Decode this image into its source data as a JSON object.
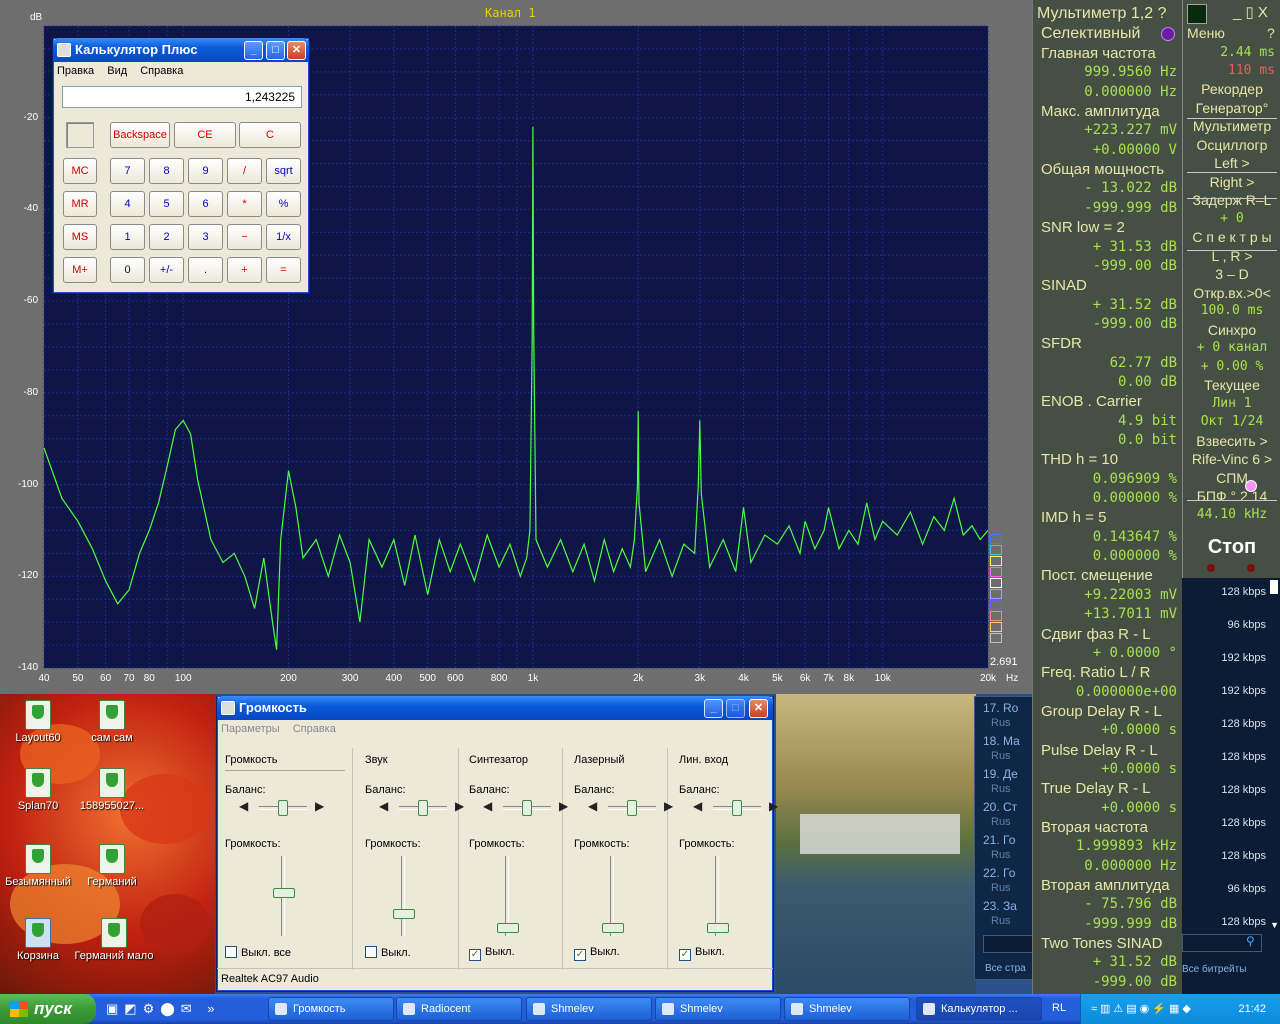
{
  "spectrum": {
    "channel_title": "Канал 1",
    "unit_db": "dB",
    "corner_value": "2.691",
    "unit_hz": "Hz",
    "colors": {
      "plot_bg": "#101548",
      "trace": "#4cff3c",
      "grid": "#1e2f8a",
      "frame": "#6e6e6e"
    },
    "chart_data": {
      "type": "line",
      "title": "Канал 1",
      "xlabel": "Hz",
      "ylabel": "dB",
      "x_scale": "log",
      "xlim": [
        40,
        20000
      ],
      "ylim": [
        -140,
        0
      ],
      "x_ticks": [
        "40",
        "50",
        "60",
        "70",
        "80",
        "100",
        "200",
        "300",
        "400",
        "500",
        "600",
        "800",
        "1k",
        "2k",
        "3k",
        "4k",
        "5k",
        "6k",
        "7k",
        "8k",
        "10k",
        "20k"
      ],
      "y_ticks": [
        "-20",
        "-40",
        "-60",
        "-80",
        "-100",
        "-120",
        "-140"
      ],
      "grid": true,
      "series": [
        {
          "points": [
            [
              40,
              -92
            ],
            [
              45,
              -103
            ],
            [
              50,
              -108
            ],
            [
              55,
              -114
            ],
            [
              60,
              -121
            ],
            [
              65,
              -126
            ],
            [
              70,
              -123
            ],
            [
              75,
              -115
            ],
            [
              80,
              -110
            ],
            [
              85,
              -104
            ],
            [
              90,
              -96
            ],
            [
              95,
              -88
            ],
            [
              100,
              -86
            ],
            [
              105,
              -89
            ],
            [
              110,
              -99
            ],
            [
              120,
              -112
            ],
            [
              130,
              -117
            ],
            [
              140,
              -115
            ],
            [
              150,
              -120
            ],
            [
              160,
              -127
            ],
            [
              170,
              -116
            ],
            [
              180,
              -130
            ],
            [
              185,
              -136
            ],
            [
              190,
              -112
            ],
            [
              200,
              -97
            ],
            [
              210,
              -105
            ],
            [
              220,
              -116
            ],
            [
              240,
              -112
            ],
            [
              260,
              -120
            ],
            [
              280,
              -111
            ],
            [
              300,
              -117
            ],
            [
              320,
              -130
            ],
            [
              340,
              -112
            ],
            [
              370,
              -118
            ],
            [
              400,
              -112
            ],
            [
              430,
              -122
            ],
            [
              460,
              -111
            ],
            [
              500,
              -124
            ],
            [
              540,
              -112
            ],
            [
              580,
              -119
            ],
            [
              620,
              -113
            ],
            [
              680,
              -121
            ],
            [
              740,
              -111
            ],
            [
              800,
              -118
            ],
            [
              860,
              -113
            ],
            [
              920,
              -120
            ],
            [
              960,
              -116
            ],
            [
              980,
              -110
            ],
            [
              995,
              -68
            ],
            [
              1000,
              -22
            ],
            [
              1005,
              -66
            ],
            [
              1020,
              -112
            ],
            [
              1100,
              -118
            ],
            [
              1200,
              -112
            ],
            [
              1300,
              -119
            ],
            [
              1400,
              -113
            ],
            [
              1500,
              -121
            ],
            [
              1600,
              -112
            ],
            [
              1700,
              -119
            ],
            [
              1800,
              -114
            ],
            [
              1900,
              -118
            ],
            [
              1950,
              -112
            ],
            [
              1990,
              -100
            ],
            [
              2000,
              -84
            ],
            [
              2010,
              -104
            ],
            [
              2100,
              -119
            ],
            [
              2300,
              -112
            ],
            [
              2500,
              -120
            ],
            [
              2700,
              -113
            ],
            [
              2900,
              -115
            ],
            [
              2970,
              -100
            ],
            [
              3000,
              -86
            ],
            [
              3030,
              -102
            ],
            [
              3200,
              -118
            ],
            [
              3500,
              -112
            ],
            [
              3800,
              -119
            ],
            [
              4000,
              -105
            ],
            [
              4200,
              -117
            ],
            [
              4600,
              -111
            ],
            [
              5000,
              -113
            ],
            [
              5400,
              -109
            ],
            [
              5800,
              -115
            ],
            [
              6000,
              -108
            ],
            [
              6400,
              -114
            ],
            [
              6800,
              -110
            ],
            [
              7000,
              -105
            ],
            [
              7500,
              -114
            ],
            [
              8000,
              -110
            ],
            [
              8500,
              -113
            ],
            [
              9000,
              -104
            ],
            [
              9500,
              -112
            ],
            [
              10000,
              -108
            ],
            [
              11000,
              -111
            ],
            [
              12000,
              -106
            ],
            [
              13000,
              -113
            ],
            [
              14000,
              -107
            ],
            [
              15000,
              -110
            ],
            [
              16000,
              -103
            ],
            [
              17000,
              -111
            ],
            [
              18000,
              -109
            ],
            [
              19000,
              -112
            ],
            [
              20000,
              -110
            ]
          ]
        }
      ]
    }
  },
  "calculator": {
    "title": "Калькулятор Плюс",
    "menu": [
      "Правка",
      "Вид",
      "Справка"
    ],
    "display": "1,243225",
    "top_buttons": [
      "Backspace",
      "CE",
      "C"
    ],
    "memory": [
      "MC",
      "MR",
      "MS",
      "M+"
    ],
    "rows": [
      [
        "7",
        "8",
        "9",
        "/",
        "sqrt"
      ],
      [
        "4",
        "5",
        "6",
        "*",
        "%"
      ],
      [
        "1",
        "2",
        "3",
        "−",
        "1/x"
      ],
      [
        "0",
        "+/-",
        ".",
        "+",
        "="
      ]
    ]
  },
  "volume": {
    "title": "Громкость",
    "menu": [
      "Параметры",
      "Справка"
    ],
    "balance_label": "Баланс:",
    "volume_label": "Громкость:",
    "channels": [
      {
        "name": "Громкость",
        "mute": "Выкл. все",
        "checked": false,
        "level": 0.55
      },
      {
        "name": "Звук",
        "mute": "Выкл.",
        "checked": false,
        "level": 0.25
      },
      {
        "name": "Синтезатор",
        "mute": "Выкл.",
        "checked": true,
        "level": 0.05
      },
      {
        "name": "Лазерный",
        "mute": "Выкл.",
        "checked": true,
        "level": 0.05
      },
      {
        "name": "Лин. вход",
        "mute": "Выкл.",
        "checked": true,
        "level": 0.05
      }
    ],
    "device": "Realtek AC97 Audio"
  },
  "desktop_icons": [
    {
      "label": "Layout60"
    },
    {
      "label": "сам сам"
    },
    {
      "label": "Splan70"
    },
    {
      "label": "158955027..."
    },
    {
      "label": "Безымянный"
    },
    {
      "label": "Германий"
    },
    {
      "label": "Корзина"
    },
    {
      "label": "Германий мало"
    }
  ],
  "multimeter": {
    "title": "Мультиметр 1,2  ?",
    "mode": "Селективный",
    "lines": [
      {
        "k": "lbl",
        "t": "Главная частота"
      },
      {
        "k": "val",
        "t": "999.9560 Hz"
      },
      {
        "k": "val",
        "t": "0.000000 Hz"
      },
      {
        "k": "lbl",
        "t": "Макс. амплитуда"
      },
      {
        "k": "val",
        "t": "+223.227 mV"
      },
      {
        "k": "val",
        "t": "+0.00000 V"
      },
      {
        "k": "lbl",
        "t": "Общая мощность"
      },
      {
        "k": "val",
        "t": "- 13.022 dB"
      },
      {
        "k": "val",
        "t": "-999.999 dB"
      },
      {
        "k": "lbl",
        "t": "SNR     low =    2"
      },
      {
        "k": "val",
        "t": "+ 31.53 dB"
      },
      {
        "k": "val",
        "t": "-999.00 dB"
      },
      {
        "k": "lbl",
        "t": "SINAD"
      },
      {
        "k": "val",
        "t": "+ 31.52 dB"
      },
      {
        "k": "val",
        "t": "-999.00 dB"
      },
      {
        "k": "lbl",
        "t": "SFDR"
      },
      {
        "k": "val",
        "t": "62.77 dB"
      },
      {
        "k": "val",
        "t": "0.00 dB"
      },
      {
        "k": "lbl",
        "t": "ENOB . Carrier"
      },
      {
        "k": "val",
        "t": "4.9 bit"
      },
      {
        "k": "val",
        "t": "0.0 bit"
      },
      {
        "k": "lbl",
        "t": "THD       h =   10"
      },
      {
        "k": "val",
        "t": "0.096909 %"
      },
      {
        "k": "val",
        "t": "0.000000 %"
      },
      {
        "k": "lbl",
        "t": "IMD       h =    5"
      },
      {
        "k": "val",
        "t": "0.143647 %"
      },
      {
        "k": "val",
        "t": "0.000000 %"
      },
      {
        "k": "lbl",
        "t": "Пост. смещение"
      },
      {
        "k": "val",
        "t": "+9.22003 mV"
      },
      {
        "k": "val",
        "t": "+13.7011 mV"
      },
      {
        "k": "lbl",
        "t": "Сдвиг фаз R - L"
      },
      {
        "k": "val",
        "t": "+  0.0000 °"
      },
      {
        "k": "lbl",
        "t": "Freq. Ratio  L / R"
      },
      {
        "k": "val",
        "t": "0.000000e+00"
      },
      {
        "k": "lbl",
        "t": "Group Delay R - L"
      },
      {
        "k": "val",
        "t": "+0.0000  s"
      },
      {
        "k": "lbl",
        "t": "Pulse Delay R - L"
      },
      {
        "k": "val",
        "t": "+0.0000  s"
      },
      {
        "k": "lbl",
        "t": "True  Delay R - L"
      },
      {
        "k": "val",
        "t": "+0.0000  s"
      },
      {
        "k": "lbl",
        "t": "Вторая частота"
      },
      {
        "k": "val",
        "t": "1.999893 kHz"
      },
      {
        "k": "val",
        "t": "0.000000 Hz"
      },
      {
        "k": "lbl",
        "t": "Вторая амплитуда"
      },
      {
        "k": "val",
        "t": "- 75.796 dB"
      },
      {
        "k": "val",
        "t": "-999.999 dB"
      },
      {
        "k": "lbl",
        "t": "Two Tones SINAD"
      },
      {
        "k": "val",
        "t": "+ 31.52 dB"
      },
      {
        "k": "val",
        "t": "-999.00 dB"
      }
    ]
  },
  "right_menu": {
    "window_controls": "_ ▯ X",
    "menu": "Меню",
    "help": "?",
    "t1": "2.44 ms",
    "t2": "110  ms",
    "items": [
      {
        "k": "y",
        "t": "Рекордер"
      },
      {
        "k": "y",
        "t": "Генератор°"
      },
      {
        "k": "y",
        "t": "Мультиметр"
      },
      {
        "k": "y",
        "t": "Осциллогр"
      },
      {
        "k": "y",
        "t": "Left       >"
      },
      {
        "k": "y",
        "t": "Right      >"
      },
      {
        "k": "y",
        "t": "Задерж R–L"
      },
      {
        "k": "g",
        "t": "+        0"
      },
      {
        "k": "y",
        "t": "С п е к т р ы"
      },
      {
        "k": "y",
        "t": "L , R      >"
      },
      {
        "k": "y",
        "t": "3 – D"
      },
      {
        "k": "y",
        "t": "Откр.вх.>0<"
      },
      {
        "k": "g",
        "t": "100.0 ms"
      },
      {
        "k": "y",
        "t": "Синхро"
      },
      {
        "k": "g",
        "t": "+ 0 канал"
      },
      {
        "k": "g",
        "t": "+ 0.00 %"
      },
      {
        "k": "y",
        "t": "Текущее"
      },
      {
        "k": "g",
        "t": "Лин       1"
      },
      {
        "k": "g",
        "t": "Окт  1/24"
      },
      {
        "k": "y",
        "t": "Взвесить >"
      },
      {
        "k": "y",
        "t": "Rife-Vinc 6 >"
      },
      {
        "k": "y",
        "t": "СПМ"
      },
      {
        "k": "y",
        "t": "БПФ ° 2 14"
      },
      {
        "k": "g",
        "t": "44.10 kHz"
      }
    ],
    "stop": "Стоп"
  },
  "radio": {
    "items": [
      "17. Ro",
      "18. Ма",
      "19. Де",
      "20. Ст",
      "21. Го",
      "22. Го",
      "23. За"
    ],
    "sub": "Rus",
    "bitrates": [
      "128 kbps",
      "96 kbps",
      "192 kbps",
      "192 kbps",
      "128 kbps",
      "128 kbps",
      "128 kbps",
      "128 kbps",
      "128 kbps",
      "96 kbps",
      "128 kbps"
    ],
    "footer_left": "Все стра",
    "footer_right": "Все битрейты"
  },
  "taskbar": {
    "start": "пуск",
    "tasks": [
      "Громкость",
      "Radiocent",
      "Shmelev",
      "Shmelev",
      "Shmelev",
      "Калькулятор ..."
    ],
    "lang": "RL",
    "clock": "21:42"
  }
}
